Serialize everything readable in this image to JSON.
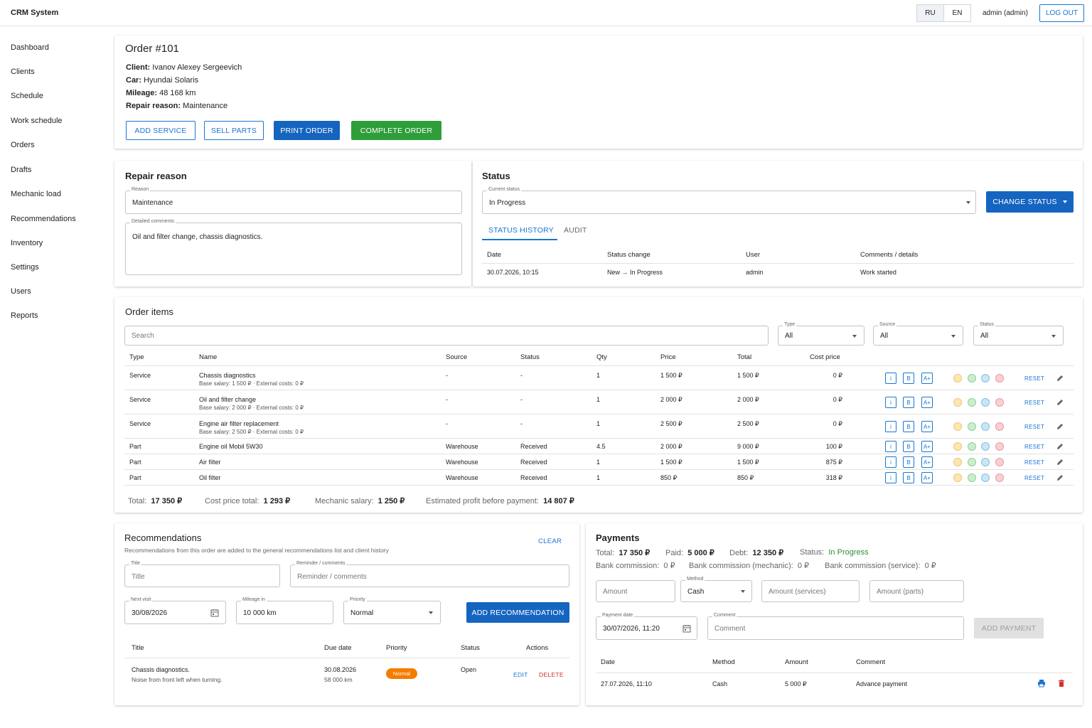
{
  "app": {
    "title": "CRM System",
    "lang_ru": "RU",
    "lang_en": "EN",
    "user": "admin (admin)",
    "logout": "LOG OUT"
  },
  "sidebar": {
    "items": [
      "Dashboard",
      "Clients",
      "Schedule",
      "Work schedule",
      "Orders",
      "Drafts",
      "Mechanic load",
      "Recommendations",
      "Inventory",
      "Settings",
      "Users",
      "Reports"
    ]
  },
  "order": {
    "title": "Order #101",
    "client_label": "Client:",
    "client": "Ivanov Alexey Sergeevich",
    "car_label": "Car:",
    "car": "Hyundai Solaris",
    "mileage_label": "Mileage:",
    "mileage": "48 168 km",
    "reason_label": "Repair reason:",
    "reason": "Maintenance",
    "buttons": {
      "add_service": "ADD SERVICE",
      "sell_parts": "SELL PARTS",
      "print": "PRINT ORDER",
      "complete": "COMPLETE ORDER"
    }
  },
  "repair": {
    "title": "Repair reason",
    "reason_label": "Reason",
    "reason_value": "Maintenance",
    "comments_label": "Detailed comments",
    "comments_value": "Oil and filter change, chassis diagnostics."
  },
  "status": {
    "title": "Status",
    "current_label": "Current status",
    "current_value": "In Progress",
    "change_button": "CHANGE STATUS",
    "tabs": [
      "STATUS HISTORY",
      "AUDIT"
    ],
    "headers": [
      "Date",
      "Status change",
      "User",
      "Comments / details"
    ],
    "rows": [
      {
        "date": "30.07.2026, 10:15",
        "change": "New → In Progress",
        "user": "admin",
        "comment": "Work started"
      }
    ]
  },
  "items": {
    "title": "Order items",
    "search_placeholder": "Search",
    "filters": {
      "type_label": "Type",
      "type_value": "All",
      "source_label": "Source",
      "source_value": "All",
      "status_label": "Status",
      "status_value": "All"
    },
    "headers": [
      "Type",
      "Name",
      "Source",
      "Status",
      "Qty",
      "Price",
      "Total",
      "Cost price"
    ],
    "rows": [
      {
        "type": "Service",
        "name": "Chassis diagnostics",
        "sub": "Base salary: 1 500 ₽ · External costs: 0 ₽",
        "source": "-",
        "status": "-",
        "qty": "1",
        "price": "1 500 ₽",
        "total": "1 500 ₽",
        "cost": "0 ₽"
      },
      {
        "type": "Service",
        "name": "Oil and filter change",
        "sub": "Base salary: 2 000 ₽ · External costs: 0 ₽",
        "source": "-",
        "status": "-",
        "qty": "1",
        "price": "2 000 ₽",
        "total": "2 000 ₽",
        "cost": "0 ₽"
      },
      {
        "type": "Service",
        "name": "Engine air filter replacement",
        "sub": "Base salary: 2 500 ₽ · External costs: 0 ₽",
        "source": "-",
        "status": "-",
        "qty": "1",
        "price": "2 500 ₽",
        "total": "2 500 ₽",
        "cost": "0 ₽"
      },
      {
        "type": "Part",
        "name": "Engine oil Mobil 5W30",
        "sub": "",
        "source": "Warehouse",
        "status": "Received",
        "qty": "4.5",
        "price": "2 000 ₽",
        "total": "9 000 ₽",
        "cost": "100 ₽"
      },
      {
        "type": "Part",
        "name": "Air filter",
        "sub": "",
        "source": "Warehouse",
        "status": "Received",
        "qty": "1",
        "price": "1 500 ₽",
        "total": "1 500 ₽",
        "cost": "875 ₽"
      },
      {
        "type": "Part",
        "name": "Oil filter",
        "sub": "",
        "source": "Warehouse",
        "status": "Received",
        "qty": "1",
        "price": "850 ₽",
        "total": "850 ₽",
        "cost": "318 ₽"
      }
    ],
    "action_labels": {
      "i": "i",
      "b": "B",
      "a": "A+",
      "reset": "RESET"
    },
    "dot_colors": [
      "#fde7b0",
      "#cdeccf",
      "#c9e6f6",
      "#f9d0d4"
    ],
    "dot_borders": [
      "#e8c87a",
      "#8fd195",
      "#7cc3e6",
      "#eb9aa2"
    ],
    "summary": {
      "total_label": "Total:",
      "total": "17 350 ₽",
      "cost_label": "Cost price total:",
      "cost": "1 293 ₽",
      "salary_label": "Mechanic salary:",
      "salary": "1 250 ₽",
      "profit_label": "Estimated profit before payment:",
      "profit": "14 807 ₽"
    }
  },
  "recommendations": {
    "title": "Recommendations",
    "subtitle": "Recommendations from this order are added to the general recommendations list and client history",
    "clear": "CLEAR",
    "title_label": "Title",
    "title_placeholder": "Title",
    "reminder_label": "Reminder / comments",
    "reminder_placeholder": "Reminder / comments",
    "next_visit_label": "Next visit",
    "next_visit": "30/08/2026",
    "mileage_label": "Mileage in",
    "mileage": "10 000 km",
    "priority_label": "Priority",
    "priority": "Normal",
    "add_button": "ADD RECOMMENDATION",
    "headers": [
      "Title",
      "Due date",
      "Priority",
      "Status",
      "Actions"
    ],
    "rows": [
      {
        "title": "Chassis diagnostics.",
        "note": "Noise from front left when turning.",
        "due": "30.08.2026",
        "due_km": "58 000 km",
        "priority": "Normal",
        "status": "Open",
        "edit": "EDIT",
        "delete": "DELETE"
      }
    ]
  },
  "payments": {
    "title": "Payments",
    "total_label": "Total:",
    "total": "17 350 ₽",
    "paid_label": "Paid:",
    "paid": "5 000 ₽",
    "debt_label": "Debt:",
    "debt": "12 350 ₽",
    "status_label": "Status:",
    "status": "In Progress",
    "bank_label": "Bank commission:",
    "bank": "0 ₽",
    "bank_mech_label": "Bank commission (mechanic):",
    "bank_mech": "0 ₽",
    "bank_serv_label": "Bank commission (service):",
    "bank_serv": "0 ₽",
    "amount_placeholder": "Amount",
    "method_label": "Method",
    "method": "Cash",
    "amount_services_placeholder": "Amount (services)",
    "amount_parts_placeholder": "Amount (parts)",
    "date_label": "Payment date",
    "date": "30/07/2026, 11:20",
    "comment_label": "Comment",
    "comment_placeholder": "Comment",
    "add_button": "ADD PAYMENT",
    "headers": [
      "Date",
      "Method",
      "Amount",
      "Comment"
    ],
    "rows": [
      {
        "date": "27.07.2026, 11:10",
        "method": "Cash",
        "amount": "5 000 ₽",
        "comment": "Advance payment"
      }
    ]
  },
  "colors": {
    "primary": "#1976d2",
    "success": "#2e9e3a",
    "danger": "#d32f2f",
    "warning": "#f57c00"
  }
}
